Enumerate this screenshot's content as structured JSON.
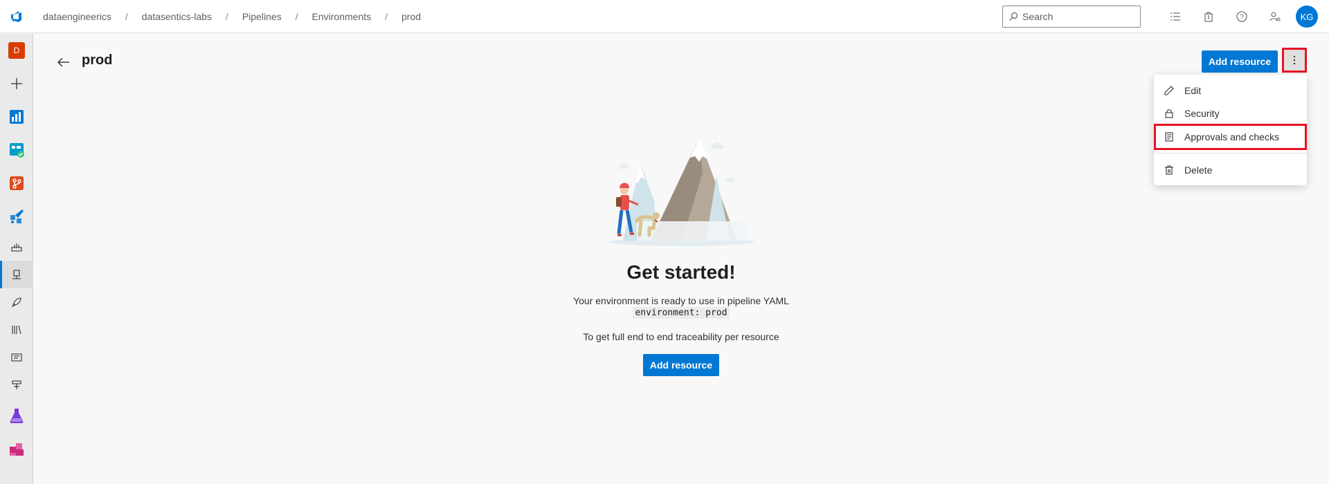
{
  "breadcrumb": [
    "dataengineerics",
    "datasentics-labs",
    "Pipelines",
    "Environments",
    "prod"
  ],
  "search": {
    "placeholder": "Search"
  },
  "user": {
    "initials": "KG"
  },
  "org": {
    "initial": "D"
  },
  "page": {
    "title": "prod"
  },
  "header": {
    "add_resource_label": "Add resource"
  },
  "menu": {
    "items": [
      {
        "label": "Edit",
        "icon": "edit-icon"
      },
      {
        "label": "Security",
        "icon": "lock-icon"
      },
      {
        "label": "Approvals and checks",
        "icon": "checklist-icon"
      },
      {
        "label": "Delete",
        "icon": "trash-icon"
      }
    ]
  },
  "empty_state": {
    "title": "Get started!",
    "line1": "Your environment is ready to use in pipeline YAML",
    "code": "environment: prod",
    "line2": "To get full end to end traceability per resource",
    "button": "Add resource"
  },
  "colors": {
    "accent": "#0078d4",
    "highlight": "#e81123",
    "org_badge": "#d83b01"
  }
}
